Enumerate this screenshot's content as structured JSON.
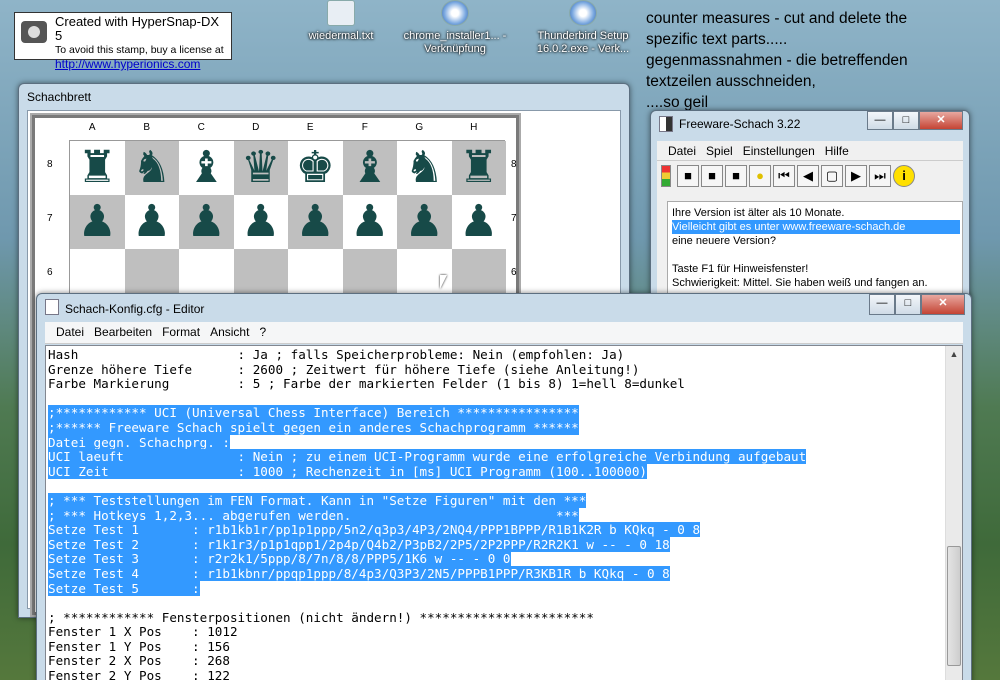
{
  "stamp": {
    "line1": "Created with HyperSnap-DX 5",
    "line2": "To avoid this stamp, buy a license at",
    "line3": "http://www.hyperionics.com"
  },
  "desktop_icons": [
    {
      "label": "wiedermal.txt"
    },
    {
      "label": "chrome_installer1... - Verknüpfung"
    },
    {
      "label": "Thunderbird Setup 16.0.2.exe - Verk..."
    }
  ],
  "note": {
    "line1": "counter measures - cut and delete the",
    "line2": "spezific text parts.....",
    "line3": "gegenmassnahmen - die betreffenden",
    "line4": "textzeilen ausschneiden,",
    "line5": "....so geil"
  },
  "board_window": {
    "title": "Schachbrett",
    "files": [
      "A",
      "B",
      "C",
      "D",
      "E",
      "F",
      "G",
      "H"
    ],
    "ranks": [
      "8",
      "7",
      "6"
    ],
    "rows": [
      [
        "♜",
        "♞",
        "♝",
        "♛",
        "♚",
        "♝",
        "♞",
        "♜"
      ],
      [
        "♟",
        "♟",
        "♟",
        "♟",
        "♟",
        "♟",
        "♟",
        "♟"
      ],
      [
        "",
        "",
        "",
        "",
        "",
        "",
        "",
        ""
      ]
    ]
  },
  "fw_window": {
    "title": "Freeware-Schach 3.22",
    "menu": [
      "Datei",
      "Spiel",
      "Einstellungen",
      "Hilfe"
    ],
    "messages": [
      "Ihre Version ist älter als 10 Monate.",
      "Vielleicht gibt es unter www.freeware-schach.de",
      "eine neuere Version?",
      "",
      "Taste F1 für Hinweisfenster!",
      "Schwierigkeit: Mittel. Sie haben weiß und fangen an."
    ]
  },
  "editor_window": {
    "title": "Schach-Konfig.cfg - Editor",
    "menu": [
      "Datei",
      "Bearbeiten",
      "Format",
      "Ansicht",
      "?"
    ],
    "lines": [
      "Hash                     : Ja ; falls Speicherprobleme: Nein (empfohlen: Ja)",
      "Grenze höhere Tiefe      : 2600 ; Zeitwert für höhere Tiefe (siehe Anleitung!)",
      "Farbe Markierung         : 5 ; Farbe der markierten Felder (1 bis 8) 1=hell 8=dunkel",
      "",
      ";************ UCI (Universal Chess Interface) Bereich ****************",
      ";****** Freeware Schach spielt gegen ein anderes Schachprogramm ******",
      "Datei gegn. Schachprg. :",
      "UCI laeuft               : Nein ; zu einem UCI-Programm wurde eine erfolgreiche Verbindung aufgebaut",
      "UCI Zeit                 : 1000 ; Rechenzeit in [ms] UCI Programm (100..100000)",
      "",
      "; *** Teststellungen im FEN Format. Kann in \"Setze Figuren\" mit den ***",
      "; *** Hotkeys 1,2,3... abgerufen werden.                           ***",
      "Setze Test 1       : r1b1kb1r/pp1p1ppp/5n2/q3p3/4P3/2NQ4/PPP1BPPP/R1B1K2R b KQkq - 0 8",
      "Setze Test 2       : r1k1r3/p1p1qpp1/2p4p/Q4b2/P3pB2/2P5/2P2PPP/R2R2K1 w -- - 0 18",
      "Setze Test 3       : r2r2k1/5ppp/8/7n/8/8/PPP5/1K6 w -- - 0 0",
      "Setze Test 4       : r1b1kbnr/ppqp1ppp/8/4p3/Q3P3/2N5/PPPB1PPP/R3KB1R b KQkq - 0 8",
      "Setze Test 5       :",
      "",
      "; ************ Fensterpositionen (nicht ändern!) ***********************",
      "Fenster 1 X Pos    : 1012",
      "Fenster 1 Y Pos    : 156",
      "Fenster 2 X Pos    : 268",
      "Fenster 2 Y Pos    : 122"
    ],
    "selected_lines": [
      4,
      5,
      6,
      7,
      8,
      10,
      11,
      12,
      13,
      14,
      15,
      16
    ]
  }
}
